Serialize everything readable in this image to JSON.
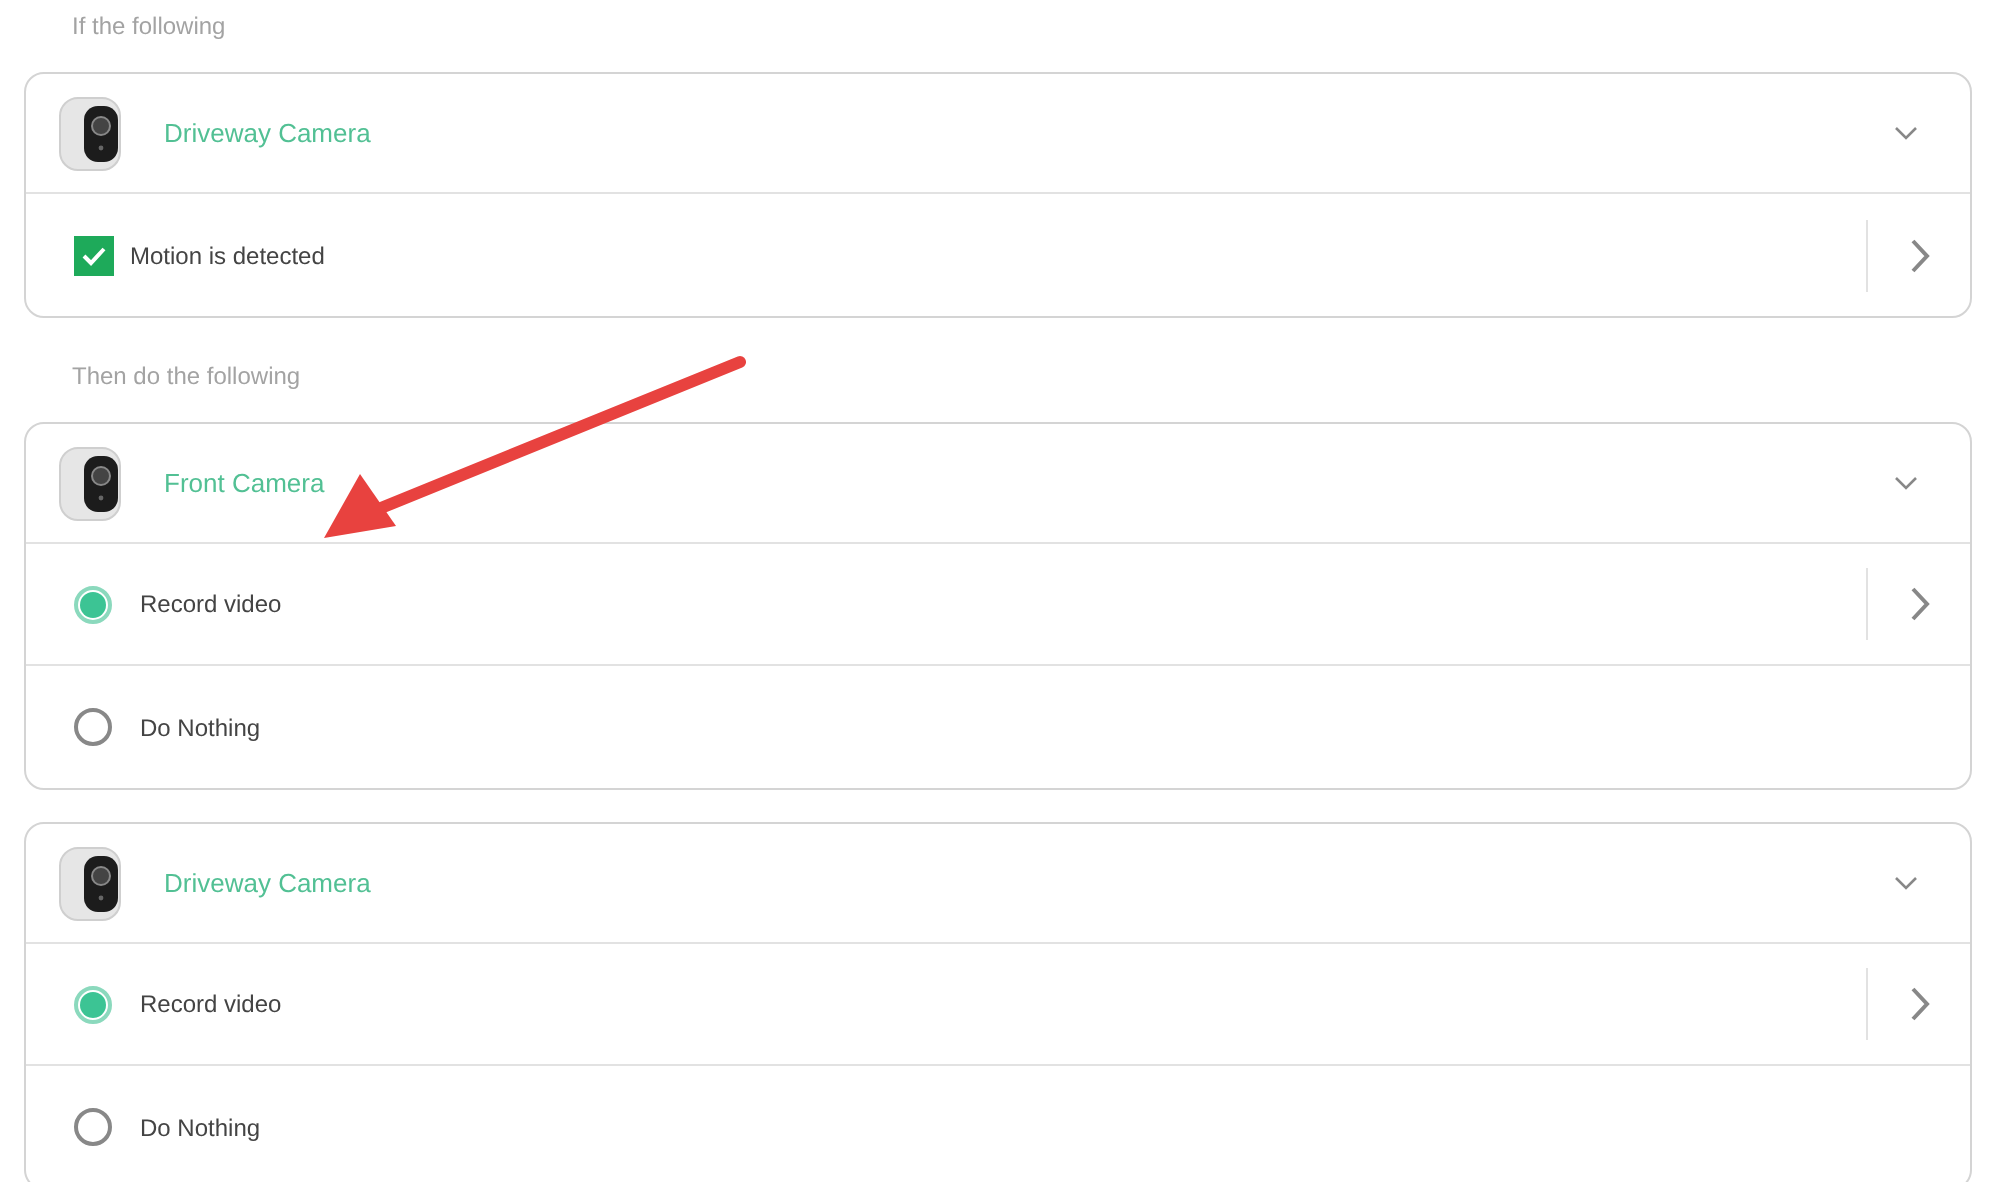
{
  "sections": [
    {
      "label": "If the following",
      "cards": [
        {
          "camera": "Driveway Camera",
          "rows": [
            {
              "kind": "checkbox",
              "label": "Motion is detected",
              "checked": true,
              "detail_button": true
            }
          ]
        }
      ]
    },
    {
      "label": "Then do the following",
      "cards": [
        {
          "camera": "Front Camera",
          "rows": [
            {
              "kind": "radio",
              "label": "Record video",
              "selected": true,
              "detail_button": true
            },
            {
              "kind": "radio",
              "label": "Do Nothing",
              "selected": false,
              "detail_button": false
            }
          ]
        },
        {
          "camera": "Driveway Camera",
          "rows": [
            {
              "kind": "radio",
              "label": "Record video",
              "selected": true,
              "detail_button": true
            },
            {
              "kind": "radio",
              "label": "Do Nothing",
              "selected": false,
              "detail_button": false
            }
          ]
        }
      ]
    }
  ]
}
